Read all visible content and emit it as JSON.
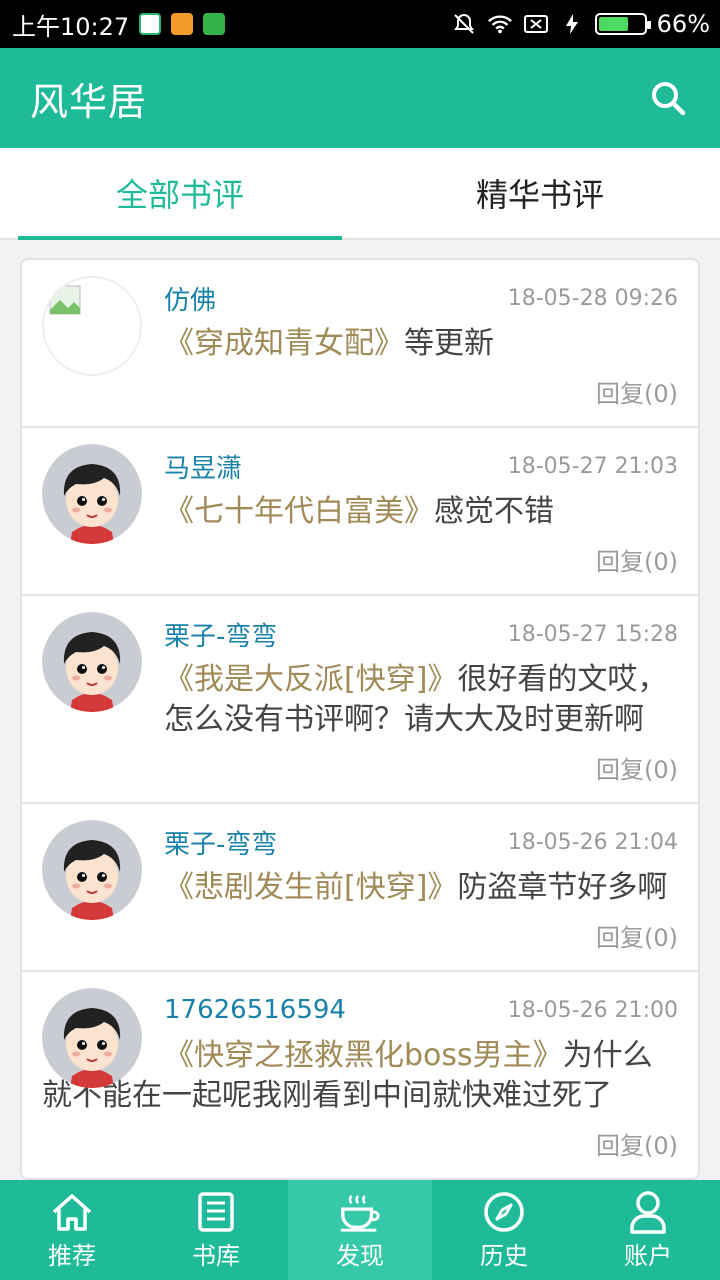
{
  "status": {
    "time": "上午10:27",
    "battery": "66%",
    "battery_level": 0.66
  },
  "app": {
    "title": "风华居"
  },
  "tabs": [
    {
      "label": "全部书评",
      "active": true
    },
    {
      "label": "精华书评",
      "active": false
    }
  ],
  "reviews": [
    {
      "user": "仿佛",
      "time": "18-05-28 09:26",
      "book": "《穿成知青女配》",
      "text": "等更新",
      "reply": "回复(0)"
    },
    {
      "user": "马昱潇",
      "time": "18-05-27 21:03",
      "book": "《七十年代白富美》",
      "text": "感觉不错",
      "reply": "回复(0)"
    },
    {
      "user": "栗子-弯弯",
      "time": "18-05-27 15:28",
      "book": "《我是大反派[快穿]》",
      "text": "很好看的文哎，怎么没有书评啊？请大大及时更新啊",
      "reply": "回复(0)"
    },
    {
      "user": "栗子-弯弯",
      "time": "18-05-26 21:04",
      "book": "《悲剧发生前[快穿]》",
      "text": "防盗章节好多啊",
      "reply": "回复(0)"
    },
    {
      "user": "17626516594",
      "time": "18-05-26 21:00",
      "book": "《快穿之拯救黑化boss男主》",
      "text": "为什么就不能在一起呢我刚看到中间就快难过死了",
      "reply": "回复(0)"
    }
  ],
  "nav": [
    {
      "label": "推荐",
      "icon": "home-icon"
    },
    {
      "label": "书库",
      "icon": "book-icon"
    },
    {
      "label": "发现",
      "icon": "coffee-icon",
      "active": true
    },
    {
      "label": "历史",
      "icon": "compass-icon"
    },
    {
      "label": "账户",
      "icon": "user-icon"
    }
  ],
  "colors": {
    "primary": "#1fbb99",
    "book_title": "#a08a57",
    "username": "#1a82a8"
  }
}
